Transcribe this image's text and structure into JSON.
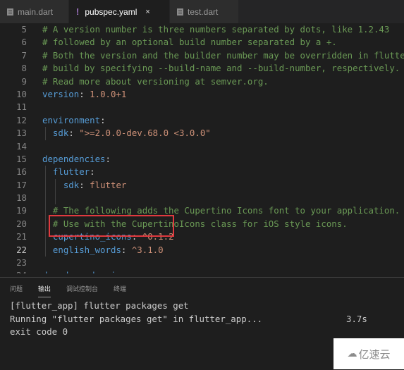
{
  "tabs": [
    {
      "label": "main.dart",
      "icon": "dart-file-icon",
      "active": false
    },
    {
      "label": "pubspec.yaml",
      "icon": "yaml-file-icon",
      "active": true,
      "close": "×",
      "icon_glyph": "!"
    },
    {
      "label": "test.dart",
      "icon": "dart-file-icon",
      "active": false
    }
  ],
  "editor": {
    "lines": [
      {
        "n": "5",
        "comment": "# A version number is three numbers separated by dots, like 1.2.43"
      },
      {
        "n": "6",
        "comment": "# followed by an optional build number separated by a +."
      },
      {
        "n": "7",
        "comment": "# Both the version and the builder number may be overridden in flutter"
      },
      {
        "n": "8",
        "comment": "# build by specifying --build-name and --build-number, respectively."
      },
      {
        "n": "9",
        "comment": "# Read more about versioning at semver.org."
      },
      {
        "n": "10",
        "key": "version",
        "value": "1.0.0+1"
      },
      {
        "n": "11"
      },
      {
        "n": "12",
        "key": "environment"
      },
      {
        "n": "13",
        "key": "sdk",
        "value": "\">=2.0.0-dev.68.0 <3.0.0\""
      },
      {
        "n": "14"
      },
      {
        "n": "15",
        "key": "dependencies"
      },
      {
        "n": "16",
        "key": "flutter"
      },
      {
        "n": "17",
        "key": "sdk",
        "value": "flutter"
      },
      {
        "n": "18"
      },
      {
        "n": "19",
        "comment": "# The following adds the Cupertino Icons font to your application."
      },
      {
        "n": "20",
        "comment": "# Use with the CupertinoIcons class for iOS style icons."
      },
      {
        "n": "21",
        "key": "cupertino_icons",
        "value": "^0.1.2"
      },
      {
        "n": "22",
        "key": "english_words",
        "value": "^3.1.0"
      },
      {
        "n": "23"
      },
      {
        "n": "24",
        "key": "dev_dependencies"
      }
    ]
  },
  "panel": {
    "tabs": [
      "问题",
      "输出",
      "调试控制台",
      "终端"
    ],
    "active_tab": "输出",
    "output": [
      {
        "text": "[flutter_app] flutter packages get"
      },
      {
        "text": "Running \"flutter packages get\" in flutter_app...",
        "time": "3.7s"
      },
      {
        "text": "exit code 0"
      }
    ]
  },
  "watermark": {
    "text": "亿速云"
  },
  "colors": {
    "highlight_border": "#e0393e",
    "comment": "#6a9955",
    "key": "#569cd6",
    "string": "#ce9178"
  }
}
